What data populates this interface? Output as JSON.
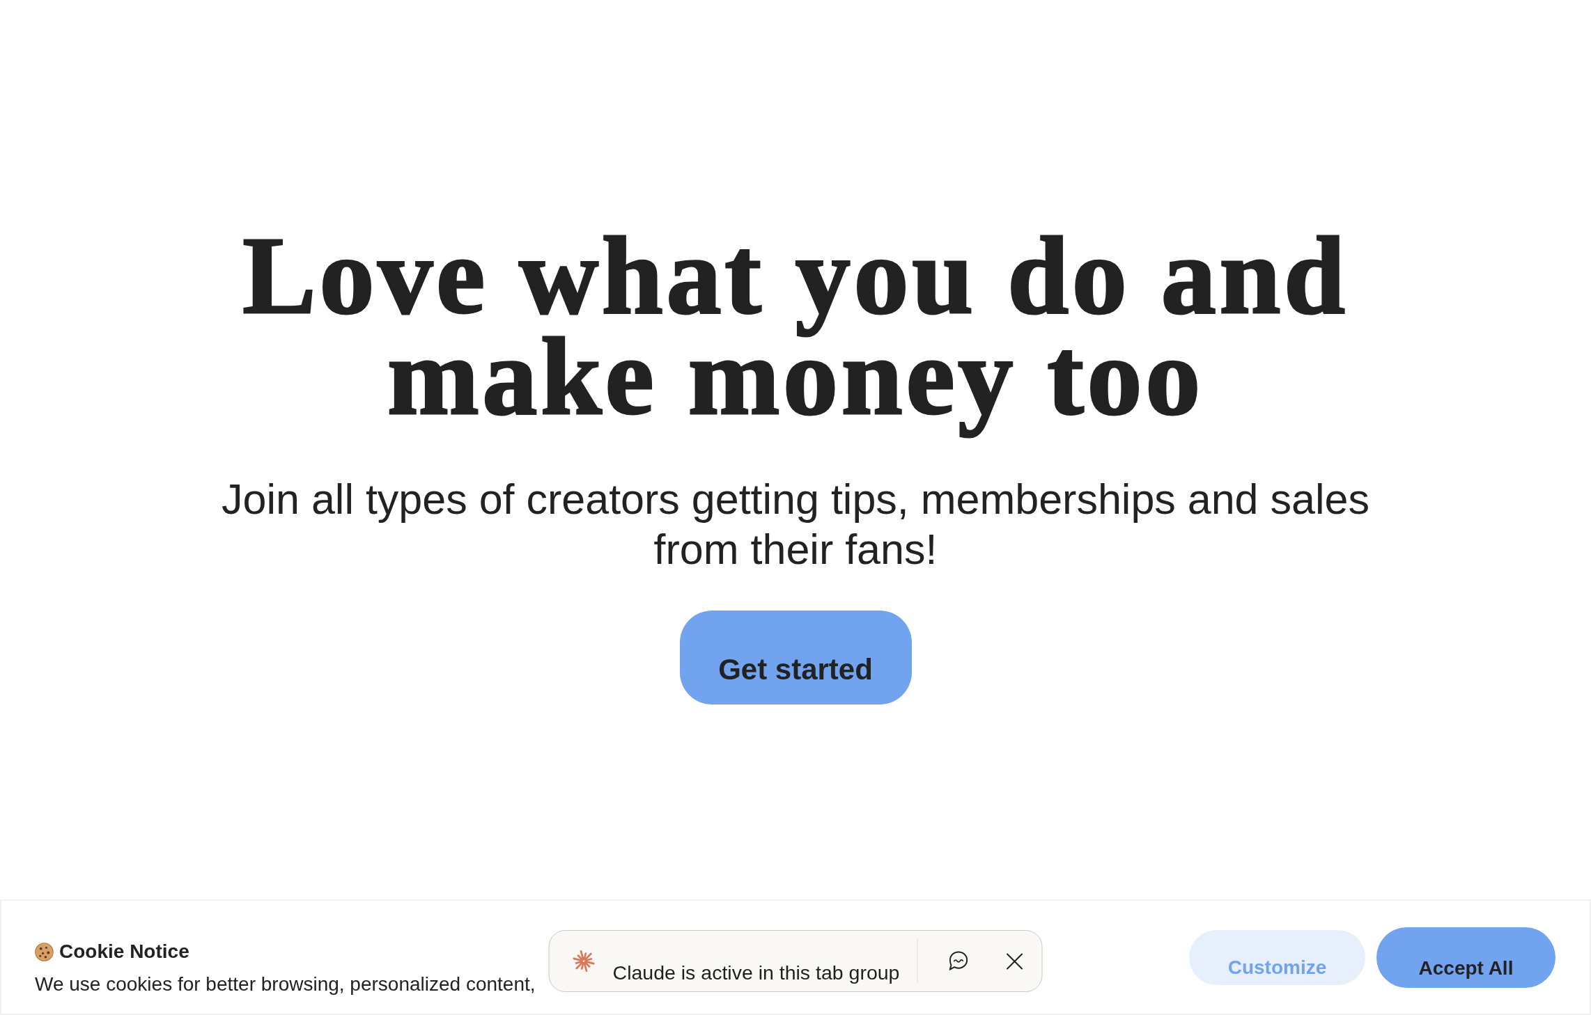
{
  "hero": {
    "headline": "Love what you do and make money too",
    "subtitle": "Join all types of creators getting tips, memberships and sales from their fans!",
    "cta": "Get started"
  },
  "cookie_banner": {
    "title": "Cookie Notice",
    "text": "We use cookies for better browsing, personalized content,",
    "buttons": [
      {
        "label": "Customize",
        "kind": "secondary"
      },
      {
        "label": "Accept All",
        "kind": "primary"
      }
    ]
  },
  "tab_group_notice": {
    "text": "Claude is active in this tab group"
  }
}
